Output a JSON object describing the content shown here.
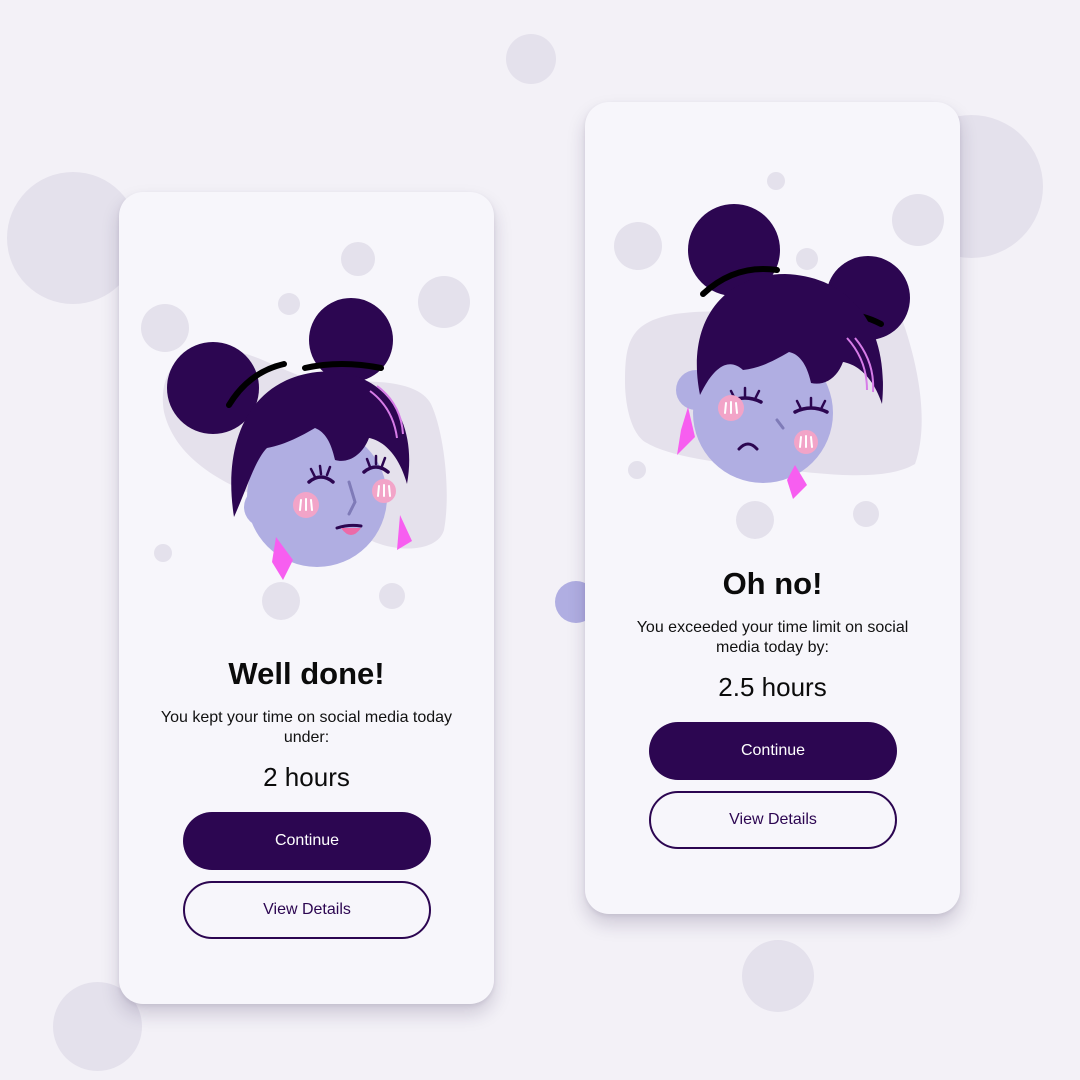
{
  "colors": {
    "background": "#f3f1f7",
    "card": "#f7f6fb",
    "primary": "#2c0651",
    "decor_dot": "#e4e1ec",
    "skin": "#b0aee2",
    "blush": "#f2a4c8",
    "earring": "#f75ef0"
  },
  "cards": [
    {
      "illustration": "happy-girl-illustration",
      "title": "Well done!",
      "message": "You kept your time on social media today under:",
      "amount": "2 hours",
      "continue_label": "Continue",
      "details_label": "View Details"
    },
    {
      "illustration": "sad-girl-illustration",
      "title": "Oh no!",
      "message": "You exceeded your time limit on social media today by:",
      "amount": "2.5 hours",
      "continue_label": "Continue",
      "details_label": "View Details"
    }
  ]
}
